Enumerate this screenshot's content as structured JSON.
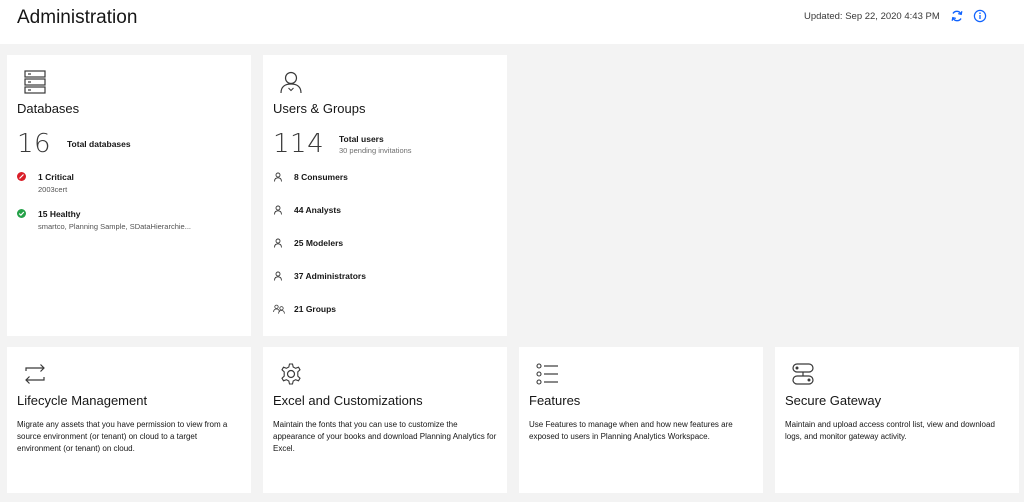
{
  "header": {
    "title": "Administration",
    "updated": "Updated: Sep 22, 2020 4:43 PM",
    "refresh_icon": "refresh-icon",
    "info_icon": "info-icon"
  },
  "databases": {
    "title": "Databases",
    "icon": "database-icon",
    "total_value": "16",
    "total_label": "Total databases",
    "critical": {
      "title": "1 Critical",
      "detail": "2003cert",
      "color": "#da1e28"
    },
    "healthy": {
      "title": "15 Healthy",
      "detail": "smartco, Planning Sample, SDataHierarchie...",
      "color": "#24a148"
    }
  },
  "users_groups": {
    "title": "Users & Groups",
    "icon": "user-icon",
    "total_value": "114",
    "total_label": "Total users",
    "pending": "30 pending invitations",
    "items": [
      {
        "label": "8 Consumers",
        "icon": "user-icon"
      },
      {
        "label": "44 Analysts",
        "icon": "user-icon"
      },
      {
        "label": "25 Modelers",
        "icon": "user-icon"
      },
      {
        "label": "37 Administrators",
        "icon": "user-icon"
      },
      {
        "label": "21 Groups",
        "icon": "group-icon"
      }
    ]
  },
  "lifecycle": {
    "title": "Lifecycle Management",
    "icon": "arrows-swap-icon",
    "description": "Migrate any assets that you have permission to view from a source environment (or tenant) on cloud to a target environment (or tenant) on cloud."
  },
  "excel": {
    "title": "Excel and Customizations",
    "icon": "gear-icon",
    "description": "Maintain the fonts that you can use to customize the appearance of your books and download Planning Analytics for Excel."
  },
  "features": {
    "title": "Features",
    "icon": "list-icon",
    "description": "Use Features to manage when and how new features are exposed to users in Planning Analytics Workspace."
  },
  "gateway": {
    "title": "Secure Gateway",
    "icon": "gateway-icon",
    "description": "Maintain and upload access control list, view and download logs, and monitor gateway activity."
  },
  "colors": {
    "accent": "#0f62fe",
    "critical": "#da1e28",
    "healthy": "#24a148"
  }
}
